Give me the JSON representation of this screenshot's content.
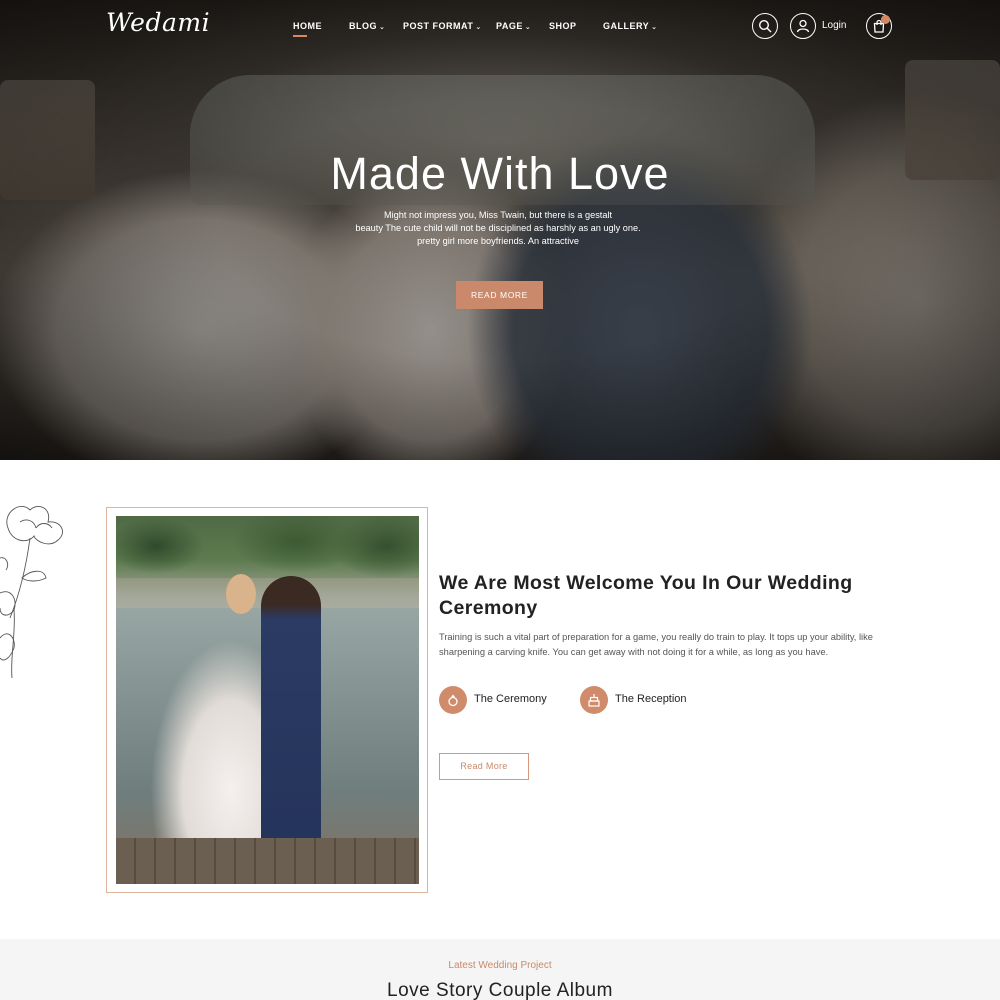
{
  "brand": {
    "logo": "Wedami",
    "accent": "#c9896a"
  },
  "nav": {
    "items": [
      {
        "label": "HOME",
        "has_dropdown": false,
        "active": true
      },
      {
        "label": "BLOG",
        "has_dropdown": true
      },
      {
        "label": "POST FORMAT",
        "has_dropdown": true
      },
      {
        "label": "PAGE",
        "has_dropdown": true
      },
      {
        "label": "SHOP",
        "has_dropdown": false
      },
      {
        "label": "GALLERY",
        "has_dropdown": true
      }
    ],
    "login_label": "Login",
    "icons": [
      "search-icon",
      "user-icon",
      "cart-icon"
    ]
  },
  "hero": {
    "title": "Made With Love",
    "subtitle_lines": [
      "Might not impress you, Miss Twain, but there is a gestalt",
      "beauty The cute child will not be disciplined as harshly as an ugly one.",
      "pretty girl more boyfriends. An attractive"
    ],
    "button_label": "READ MORE"
  },
  "welcome": {
    "title": "We Are Most Welcome You In Our Wedding Ceremony",
    "text": "Training is such a vital part of preparation for a game, you really do train to play. It tops up your ability, like sharpening a carving knife. You can get away with not doing it for a while, as long as you have.",
    "features": [
      {
        "label": "The Ceremony",
        "icon": "ring-icon"
      },
      {
        "label": "The Reception",
        "icon": "cake-icon"
      }
    ],
    "button_label": "Read More"
  },
  "latest": {
    "subtitle": "Latest Wedding Project",
    "title": "Love Story Couple Album"
  }
}
